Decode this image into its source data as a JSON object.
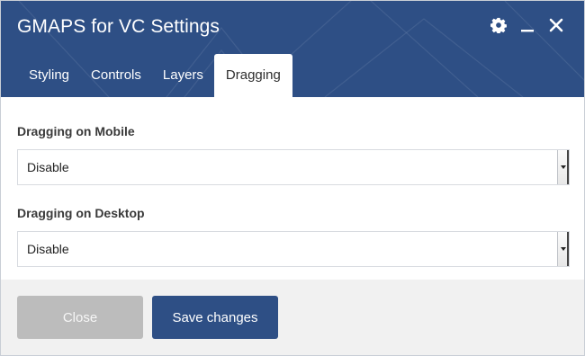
{
  "dialog": {
    "title": "GMAPS for VC Settings",
    "icons": [
      "gear-icon",
      "minimize-icon",
      "close-icon"
    ]
  },
  "tabs": [
    {
      "label": "Styling",
      "active": false
    },
    {
      "label": "Controls",
      "active": false
    },
    {
      "label": "Layers",
      "active": false
    },
    {
      "label": "Dragging",
      "active": true
    }
  ],
  "fields": {
    "mobile": {
      "label": "Dragging on Mobile",
      "value": "Disable"
    },
    "desktop": {
      "label": "Dragging on Desktop",
      "value": "Disable"
    }
  },
  "footer": {
    "close_label": "Close",
    "save_label": "Save changes"
  },
  "colors": {
    "header": "#2e4f85",
    "primary_button": "#2e4f85",
    "disabled_button": "#bcbcbc",
    "footer_bg": "#f1f1f1"
  }
}
